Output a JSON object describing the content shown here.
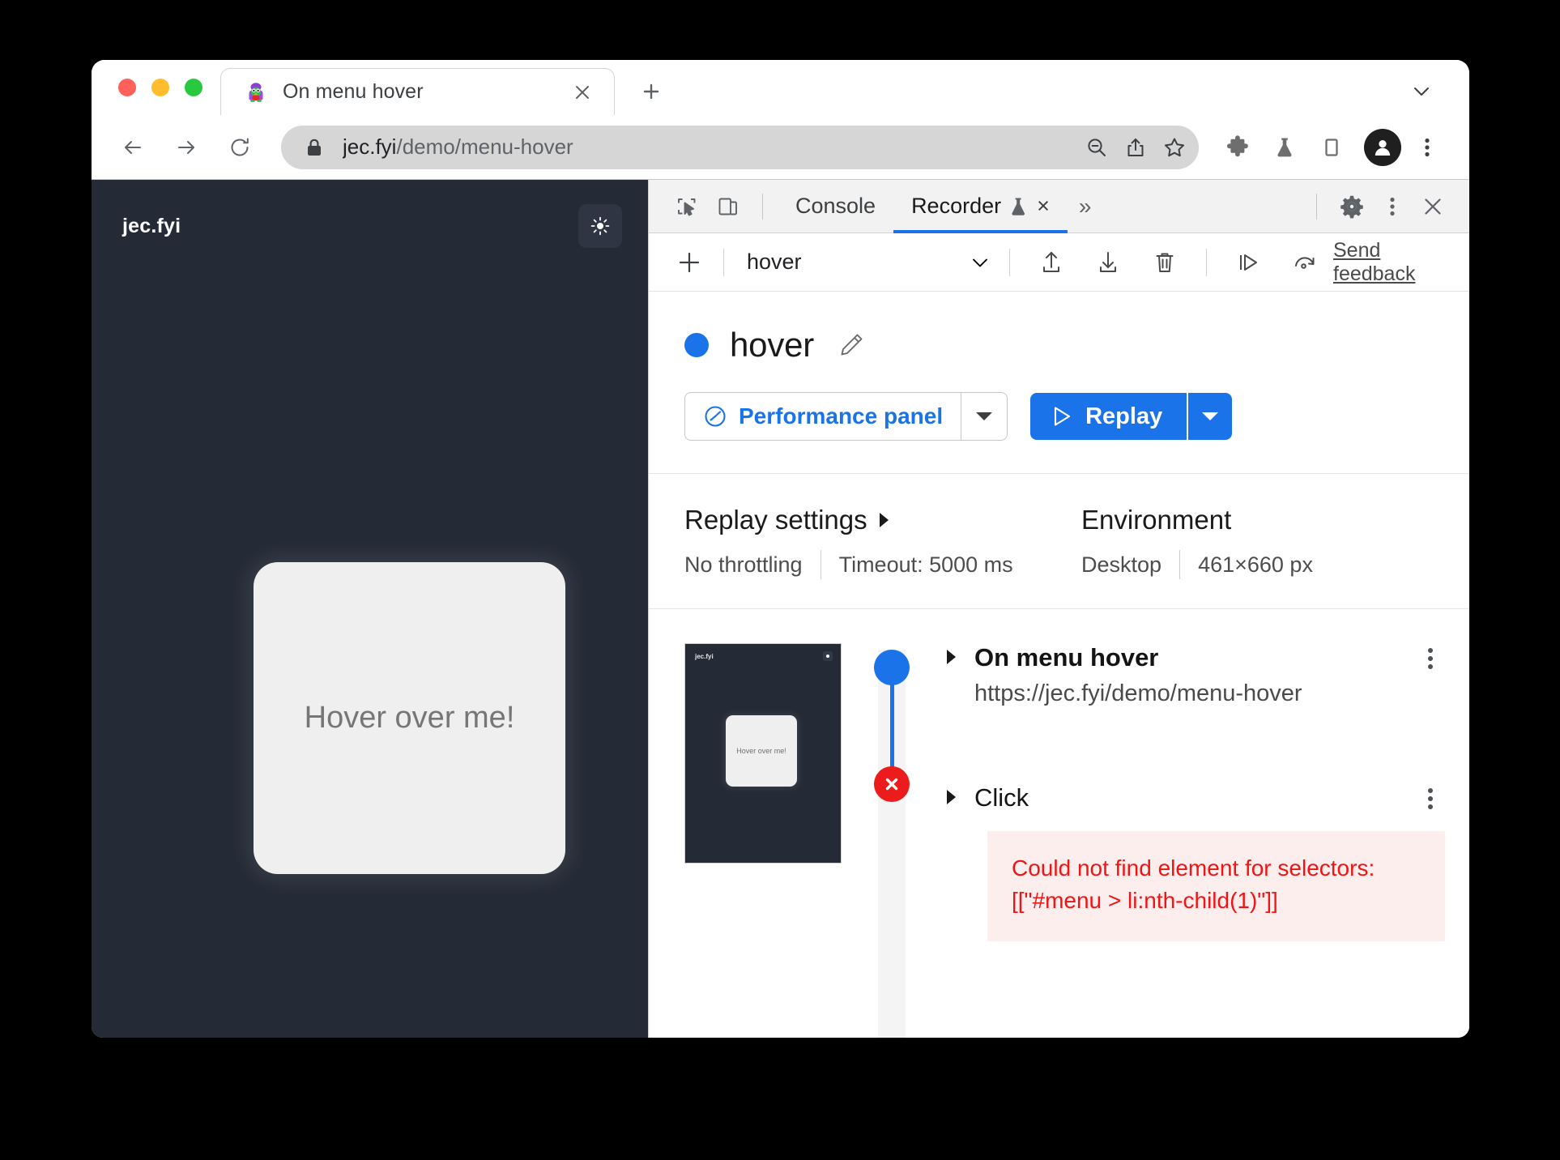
{
  "browser": {
    "tab": {
      "title": "On menu hover",
      "favicon": "penguin-favicon",
      "close_label": "×"
    },
    "newtab_label": "+",
    "omnibox": {
      "host": "jec.fyi",
      "path": "/demo/menu-hover",
      "full_url": "jec.fyi/demo/menu-hover",
      "lock_icon": "lock-icon"
    },
    "toolbar_icons": [
      "zoom-out-icon",
      "share-icon",
      "bookmark-star-icon",
      "extensions-puzzle-icon",
      "experiments-flask-icon",
      "side-panel-icon",
      "profile-avatar-icon",
      "browser-menu-kebab-icon"
    ]
  },
  "page": {
    "brand": "jec.fyi",
    "theme_toggle_icon": "sun-icon",
    "card_text": "Hover over me!"
  },
  "devtools": {
    "tabs": [
      {
        "label": "Console",
        "active": false
      },
      {
        "label": "Recorder",
        "active": true
      }
    ],
    "recorder_tab_flask_icon": "flask-icon",
    "recorder_tab_close": "×",
    "more_tabs": "»",
    "settings_icon": "gear-icon",
    "menu_icon": "kebab-icon",
    "close_icon": "close-icon",
    "inspect_icon": "inspect-cursor-icon",
    "device_icon": "device-toolbar-icon"
  },
  "recorder_toolbar": {
    "add_label": "+",
    "selected_recording": "hover",
    "dropdown_icon": "chevron-down-icon",
    "icons": [
      "export-upload-icon",
      "import-download-icon",
      "delete-trash-icon",
      "step-replay-icon",
      "record-again-icon"
    ],
    "feedback_label": "Send feedback"
  },
  "recording": {
    "status_dot_color": "#1a73e8",
    "name": "hover",
    "edit_icon": "pencil-edit-icon",
    "performance_button": {
      "label": "Performance panel",
      "icon": "performance-gauge-icon",
      "dropdown_icon": "chevron-down-icon"
    },
    "replay_button": {
      "label": "Replay",
      "icon": "play-triangle-icon",
      "dropdown_icon": "chevron-down-icon"
    }
  },
  "settings": {
    "replay": {
      "heading": "Replay settings",
      "expand_icon": "caret-right-icon",
      "throttling": "No throttling",
      "timeout": "Timeout: 5000 ms"
    },
    "environment": {
      "heading": "Environment",
      "device": "Desktop",
      "viewport": "461×660 px"
    }
  },
  "thumbnail": {
    "brand": "jec.fyi",
    "card_text": "Hover over me!"
  },
  "steps": [
    {
      "title": "On menu hover",
      "url": "https://jec.fyi/demo/menu-hover",
      "status": "start",
      "caret": "caret-right-icon",
      "menu_icon": "kebab-icon"
    },
    {
      "title": "Click",
      "url": "",
      "status": "error",
      "caret": "caret-right-icon",
      "menu_icon": "kebab-icon"
    }
  ],
  "error": {
    "line1": "Could not find element for selectors:",
    "line2": "[[\"#menu > li:nth-child(1)\"]]",
    "color": "#f11414",
    "background": "#fdeeee"
  }
}
